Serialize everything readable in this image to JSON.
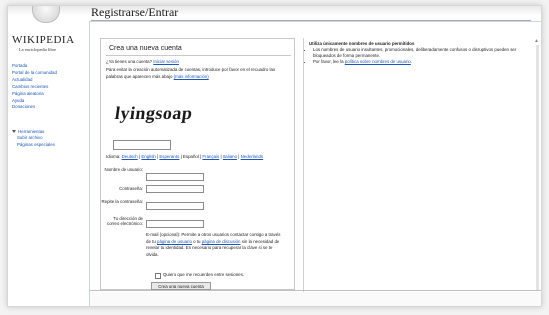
{
  "logo": {
    "wordmark": "WIKIPEDIA",
    "tagline": "La enciclopedia libre"
  },
  "sidebar": {
    "nav": [
      "Portada",
      "Portal de la comunidad",
      "Actualidad",
      "Cambios recientes",
      "Página aleatoria",
      "Ayuda",
      "Donaciones"
    ],
    "tools_label": "Herramientas",
    "tools": [
      "Subir archivo",
      "Páginas especiales"
    ]
  },
  "page": {
    "title": "Registrarse/Entrar"
  },
  "form": {
    "heading": "Crea una nueva cuenta",
    "have_account_text": "¿Ya tienes una cuenta?",
    "login_link": "Iniciar sesión",
    "captcha_intro": "Para evitar la creación automatizada de cuentas, introduce por favor en el recuadro las palabras que aparecen más abajo",
    "more_info_link": "(más información)",
    "captcha_word": "lyingsoap",
    "captcha_value": "",
    "language_label": "Idioma:",
    "languages": [
      "Deutsch",
      "English",
      "Esperanto",
      "Español",
      "Français",
      "Italiano",
      "Nederlands"
    ],
    "username_label": "Nombre de usuario:",
    "password_label": "Contraseña:",
    "retype_label": "Repite la contraseña:",
    "email_label": "Tu dirección de correo electrónico:",
    "username_value": "",
    "password_value": "",
    "retype_value": "",
    "email_value": "",
    "email_note_prefix": "E-mail (opcional): Permite a otros usuarios contactar contigo a través de tu ",
    "email_note_link1": "página de usuario",
    "email_note_mid": " o tu ",
    "email_note_link2": "página de discusión",
    "email_note_suffix": " sin la necesidad de revelar tu identidad. Es necesario para recuperar la clave si se te olvida.",
    "remember_label": "Quiero que me recuerden entre sesiones.",
    "submit_label": "Crea una nueva cuenta"
  },
  "rules": {
    "heading": "Utiliza únicamente nombres de usuario permitidos",
    "item1": "Los nombres de usuario insultantes, promocionales, deliberadamente confusos o disruptivos pueden ser bloqueados de forma permanente.",
    "item2_prefix": "Por favor, lee la ",
    "item2_link": "política sobre nombres de usuario",
    "item2_suffix": "."
  }
}
